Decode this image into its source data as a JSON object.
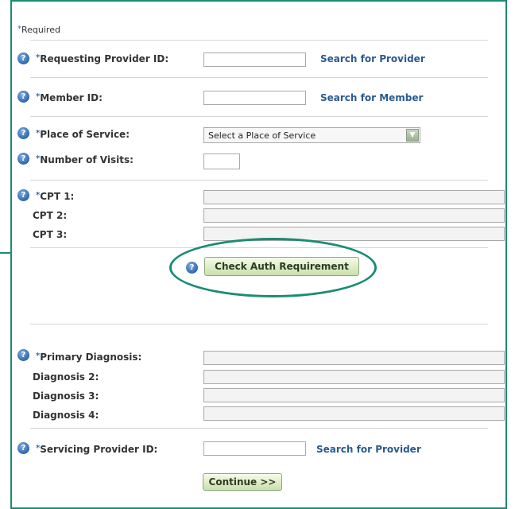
{
  "form": {
    "required_note": "Required",
    "required_star": "*",
    "help_icon_glyph": "?",
    "requesting_provider": {
      "label": "Requesting Provider ID:",
      "value": "",
      "link": "Search for Provider"
    },
    "member": {
      "label": "Member ID:",
      "value": "",
      "link": "Search for Member"
    },
    "place_of_service": {
      "label": "Place of Service:",
      "selected": "Select a Place of Service"
    },
    "number_of_visits": {
      "label": "Number of Visits:",
      "value": ""
    },
    "cpt": [
      {
        "label": "CPT 1:",
        "value": ""
      },
      {
        "label": "CPT 2:",
        "value": ""
      },
      {
        "label": "CPT 3:",
        "value": ""
      }
    ],
    "check_auth_button": "Check Auth Requirement",
    "diagnosis": [
      {
        "label": "Primary Diagnosis:",
        "value": ""
      },
      {
        "label": "Diagnosis 2:",
        "value": ""
      },
      {
        "label": "Diagnosis 3:",
        "value": ""
      },
      {
        "label": "Diagnosis 4:",
        "value": ""
      }
    ],
    "servicing_provider": {
      "label": "Servicing Provider ID:",
      "value": "",
      "link": "Search for Provider"
    },
    "continue_button": "Continue >>"
  },
  "colors": {
    "frame": "#1a8c73",
    "link": "#2a5a8f",
    "button_top": "#f6fbe8",
    "button_bottom": "#c9e0ac"
  }
}
